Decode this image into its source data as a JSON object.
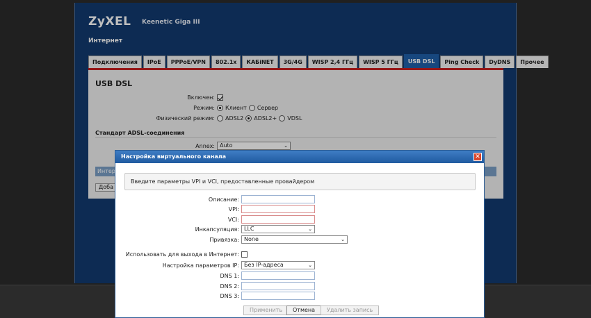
{
  "header": {
    "logo": "ZyXEL",
    "model": "Keenetic Giga III",
    "section": "Интернет"
  },
  "tabs": [
    {
      "label": "Подключения",
      "active": false
    },
    {
      "label": "IPoE",
      "active": false
    },
    {
      "label": "PPPoE/VPN",
      "active": false
    },
    {
      "label": "802.1x",
      "active": false
    },
    {
      "label": "КАБiNET",
      "active": false
    },
    {
      "label": "3G/4G",
      "active": false
    },
    {
      "label": "WISP 2,4 ГГц",
      "active": false
    },
    {
      "label": "WISP 5 ГГц",
      "active": false
    },
    {
      "label": "USB DSL",
      "active": true
    },
    {
      "label": "Ping Check",
      "active": false
    },
    {
      "label": "DyDNS",
      "active": false
    },
    {
      "label": "Прочее",
      "active": false
    }
  ],
  "panel": {
    "title": "USB DSL",
    "enabled_label": "Включен:",
    "mode_label": "Режим:",
    "mode_client": "Клиент",
    "mode_server": "Сервер",
    "phys_label": "Физический режим:",
    "phys_adsl2": "ADSL2",
    "phys_adsl2plus": "ADSL2+",
    "phys_vdsl": "VDSL",
    "standard_heading": "Стандарт ADSL-соединения",
    "annex_label": "Annex:",
    "annex_value": "Auto",
    "strip_text": "Интер",
    "add_button": "Доба"
  },
  "dialog": {
    "title": "Настройка виртуального канала",
    "close_glyph": "✕",
    "info": "Введите параметры VPI и VCI, предоставленные провайдером",
    "description_label": "Описание:",
    "vpi_label": "VPI:",
    "vci_label": "VCI:",
    "encap_label": "Инкапсуляция:",
    "encap_value": "LLC",
    "binding_label": "Привязка:",
    "binding_value": "None",
    "use_internet_label": "Использовать для выхода в Интернет:",
    "ip_settings_label": "Настройка параметров IP:",
    "ip_settings_value": "Без IP-адреса",
    "dns1_label": "DNS 1:",
    "dns2_label": "DNS 2:",
    "dns3_label": "DNS 3:",
    "apply_button": "Применить",
    "cancel_button": "Отмена",
    "delete_button": "Удалить запись"
  }
}
